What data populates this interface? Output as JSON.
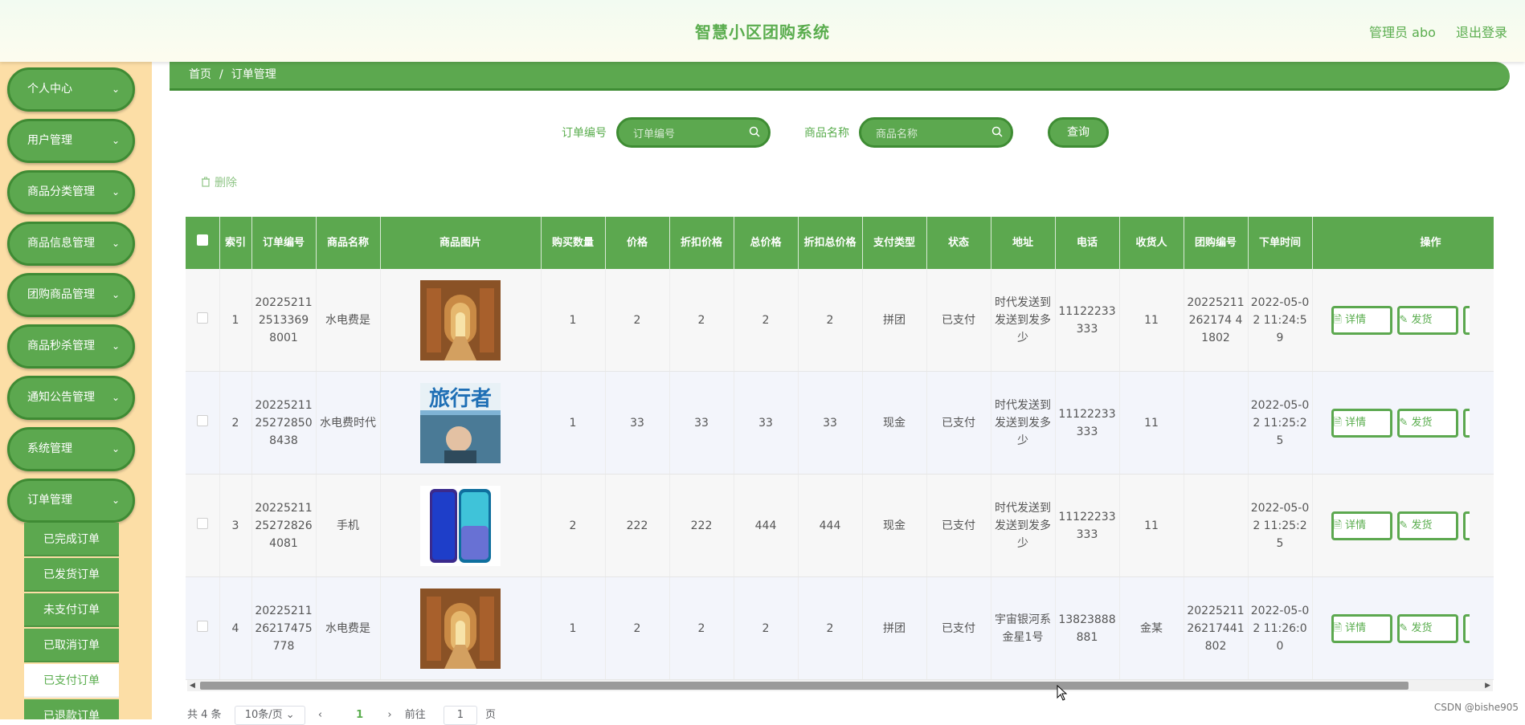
{
  "header": {
    "title": "智慧小区团购系统",
    "user": "管理员 abo",
    "logout": "退出登录"
  },
  "sidebar": {
    "items": [
      "个人中心",
      "用户管理",
      "商品分类管理",
      "商品信息管理",
      "团购商品管理",
      "商品秒杀管理",
      "通知公告管理",
      "系统管理",
      "订单管理"
    ],
    "sub_items": [
      "已完成订单",
      "已发货订单",
      "未支付订单",
      "已取消订单",
      "已支付订单",
      "已退款订单"
    ],
    "active_sub": "已支付订单"
  },
  "breadcrumb": {
    "home": "首页",
    "separator": "/",
    "current": "订单管理"
  },
  "search": {
    "order_label": "订单编号",
    "order_placeholder": "订单编号",
    "product_label": "商品名称",
    "product_placeholder": "商品名称",
    "query": "查询"
  },
  "toolbar": {
    "delete": "删除"
  },
  "table": {
    "columns": [
      "索引",
      "订单编号",
      "商品名称",
      "商品图片",
      "购买数量",
      "价格",
      "折扣价格",
      "总价格",
      "折扣总价格",
      "支付类型",
      "状态",
      "地址",
      "电话",
      "收货人",
      "团购编号",
      "下单时间",
      "操作"
    ],
    "rows": [
      {
        "index": "1",
        "order_no": "202252112513369 8001",
        "name": "水电费是",
        "image": "library",
        "qty": "1",
        "price": "2",
        "discount_price": "2",
        "total": "2",
        "discount_total": "2",
        "pay_type": "拼团",
        "status": "已支付",
        "address": "时代发送到发送到发多少",
        "phone": "11122233333",
        "receiver": "11",
        "group_no": "20225211262174 41802",
        "time": "2022-05-02 11:24:59"
      },
      {
        "index": "2",
        "order_no": "20225211252728508438",
        "name": "水电费时代",
        "image": "magazine",
        "qty": "1",
        "price": "33",
        "discount_price": "33",
        "total": "33",
        "discount_total": "33",
        "pay_type": "现金",
        "status": "已支付",
        "address": "时代发送到发送到发多少",
        "phone": "11122233333",
        "receiver": "11",
        "group_no": "",
        "time": "2022-05-02 11:25:25"
      },
      {
        "index": "3",
        "order_no": "20225211252728264081",
        "name": "手机",
        "image": "phone",
        "qty": "2",
        "price": "222",
        "discount_price": "222",
        "total": "444",
        "discount_total": "444",
        "pay_type": "现金",
        "status": "已支付",
        "address": "时代发送到发送到发多少",
        "phone": "11122233333",
        "receiver": "11",
        "group_no": "",
        "time": "2022-05-02 11:25:25"
      },
      {
        "index": "4",
        "order_no": "2022521126217475778",
        "name": "水电费是",
        "image": "library",
        "qty": "1",
        "price": "2",
        "discount_price": "2",
        "total": "2",
        "discount_total": "2",
        "pay_type": "拼团",
        "status": "已支付",
        "address": "宇宙银河系金星1号",
        "phone": "13823888881",
        "receiver": "金某",
        "group_no": "2022521126217441802",
        "time": "2022-05-02 11:26:00"
      }
    ],
    "ops": {
      "detail": "详情",
      "ship": "发货"
    }
  },
  "pager": {
    "total": "共 4 条",
    "size": "10条/页",
    "current": "1",
    "goto": "前往",
    "goto_value": "1",
    "page_unit": "页"
  },
  "watermark": "CSDN @bishe905",
  "colors": {
    "primary": "#5ca84f",
    "sidebar_bg": "#fcdea6",
    "title": "#5aad4e"
  }
}
